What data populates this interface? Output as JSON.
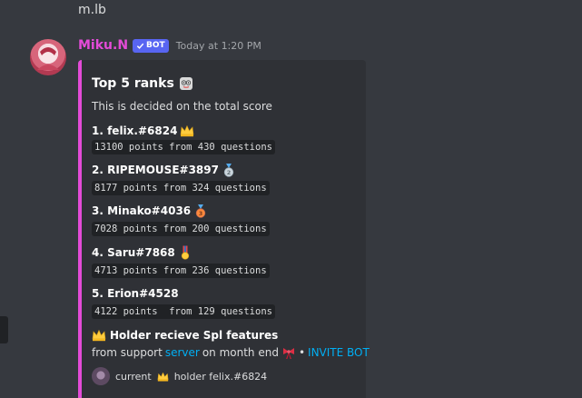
{
  "previous_message": {
    "text": "m.lb"
  },
  "message": {
    "author": "Miku.N",
    "bot_tag": "BOT",
    "timestamp": "Today at 1:20 PM",
    "author_color": "#e44bd8"
  },
  "embed": {
    "accent_color": "#e44bd8",
    "title": "Top 5 ranks",
    "description": "This is decided on the total score",
    "ranks": [
      {
        "name": "1. felix.#6824",
        "stats": "13100 points from 430 questions",
        "icon": "crown-icon"
      },
      {
        "name": "2. RIPEMOUSE#3897",
        "stats": "8177 points from 324 questions",
        "icon": "silver-medal-icon"
      },
      {
        "name": "3. Minako#4036",
        "stats": "7028 points from 200 questions",
        "icon": "bronze-medal-icon"
      },
      {
        "name": "4. Saru#7868",
        "stats": "4713 points from 236 questions",
        "icon": "military-medal-icon"
      },
      {
        "name": "5. Erion#4528",
        "stats": "4122 points  from 129 questions",
        "icon": ""
      }
    ],
    "holder_title": "Holder recieve Spl features",
    "support_prefix": "from support",
    "support_link": "server",
    "support_suffix": "on month end",
    "separator": "•",
    "invite_link": "INVITE BOT",
    "footer_current": "current",
    "footer_holder": "holder felix.#6824"
  }
}
